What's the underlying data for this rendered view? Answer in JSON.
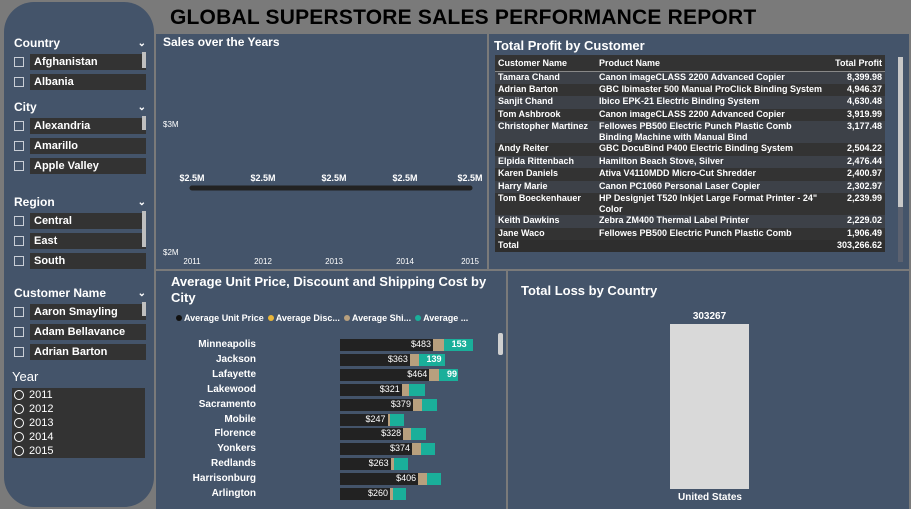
{
  "report_title": "GLOBAL SUPERSTORE SALES PERFORMANCE REPORT",
  "colors": {
    "panel": "#44546a",
    "background": "#7a7a7a",
    "bar_dark": "#222222",
    "bar_tan": "#b8a07e",
    "bar_teal": "#1aaf9a",
    "loss_bar": "#d9d9d9"
  },
  "slicers": {
    "country": {
      "label": "Country",
      "items": [
        "Afghanistan",
        "Albania"
      ]
    },
    "city": {
      "label": "City",
      "items": [
        "Alexandria",
        "Amarillo",
        "Apple Valley"
      ]
    },
    "region": {
      "label": "Region",
      "items": [
        "Central",
        "East",
        "South"
      ]
    },
    "customer": {
      "label": "Customer Name",
      "items": [
        "Aaron Smayling",
        "Adam Bellavance",
        "Adrian Barton"
      ]
    },
    "year": {
      "label": "Year",
      "items": [
        "2011",
        "2012",
        "2013",
        "2014",
        "2015"
      ]
    }
  },
  "sales_chart": {
    "title": "Sales over the Years",
    "chart_data": {
      "type": "line",
      "x": [
        "2011",
        "2012",
        "2013",
        "2014",
        "2015"
      ],
      "values": [
        2.5,
        2.5,
        2.5,
        2.5,
        2.5
      ],
      "data_labels": [
        "$2.5M",
        "$2.5M",
        "$2.5M",
        "$2.5M",
        "$2.5M"
      ],
      "y_ticks": [
        "$3M",
        "$2M"
      ],
      "ylim": [
        2,
        3
      ]
    }
  },
  "profit_table": {
    "title": "Total Profit by Customer",
    "columns": [
      "Customer Name",
      "Product Name",
      "Total Profit"
    ],
    "rows": [
      [
        "Tamara Chand",
        "Canon imageCLASS 2200 Advanced Copier",
        "8,399.98"
      ],
      [
        "Adrian Barton",
        "GBC Ibimaster 500 Manual ProClick Binding System",
        "4,946.37"
      ],
      [
        "Sanjit Chand",
        "Ibico EPK-21 Electric Binding System",
        "4,630.48"
      ],
      [
        "Tom Ashbrook",
        "Canon imageCLASS 2200 Advanced Copier",
        "3,919.99"
      ],
      [
        "Christopher Martinez",
        "Fellowes PB500 Electric Punch Plastic Comb Binding Machine with Manual Bind",
        "3,177.48"
      ],
      [
        "Andy Reiter",
        "GBC DocuBind P400 Electric Binding System",
        "2,504.22"
      ],
      [
        "Elpida Rittenbach",
        "Hamilton Beach Stove, Silver",
        "2,476.44"
      ],
      [
        "Karen Daniels",
        "Ativa V4110MDD Micro-Cut Shredder",
        "2,400.97"
      ],
      [
        "Harry Marie",
        "Canon PC1060 Personal Laser Copier",
        "2,302.97"
      ],
      [
        "Tom Boeckenhauer",
        "HP Designjet T520 Inkjet Large Format Printer - 24\" Color",
        "2,239.99"
      ],
      [
        "Keith Dawkins",
        "Zebra ZM400 Thermal Label Printer",
        "2,229.02"
      ],
      [
        "Jane Waco",
        "Fellowes PB500 Electric Punch Plastic Comb",
        "1,906.49"
      ]
    ],
    "total_label": "Total",
    "total_value": "303,266.62"
  },
  "city_chart": {
    "title_line1": "Average Unit Price, Discount and Shipping Cost by",
    "title_line2": "City",
    "legend": [
      {
        "label": "Average Unit Price",
        "color": "#111111"
      },
      {
        "label": "Average Disc...",
        "color": "#e8b53a"
      },
      {
        "label": "Average Shi...",
        "color": "#b8a07e"
      },
      {
        "label": "Average ...",
        "color": "#1aaf9a"
      }
    ],
    "chart_data": {
      "type": "bar",
      "categories": [
        "Minneapolis",
        "Jackson",
        "Lafayette",
        "Lakewood",
        "Sacramento",
        "Mobile",
        "Florence",
        "Yonkers",
        "Redlands",
        "Harrisonburg",
        "Arlington"
      ],
      "series": [
        {
          "name": "Average Unit Price",
          "values": [
            483,
            363,
            464,
            321,
            379,
            247,
            328,
            374,
            263,
            406,
            260
          ],
          "labels": [
            "$483",
            "$363",
            "$464",
            "$321",
            "$379",
            "$247",
            "$328",
            "$374",
            "$263",
            "$406",
            "$260"
          ]
        },
        {
          "name": "Average Shipping Cost",
          "values": [
            55,
            45,
            50,
            40,
            45,
            15,
            40,
            45,
            15,
            45,
            15
          ]
        },
        {
          "name": "Average Discount",
          "values": [
            153,
            139,
            99,
            80,
            80,
            70,
            80,
            75,
            75,
            75,
            70
          ],
          "labels": [
            "153",
            "139",
            "99",
            "",
            "",
            "",
            "",
            "",
            "",
            "",
            ""
          ]
        }
      ]
    }
  },
  "loss_chart": {
    "title": "Total Loss by Country",
    "chart_data": {
      "type": "bar",
      "categories": [
        "United States"
      ],
      "values": [
        303267
      ],
      "data_labels": [
        "303267"
      ]
    }
  }
}
